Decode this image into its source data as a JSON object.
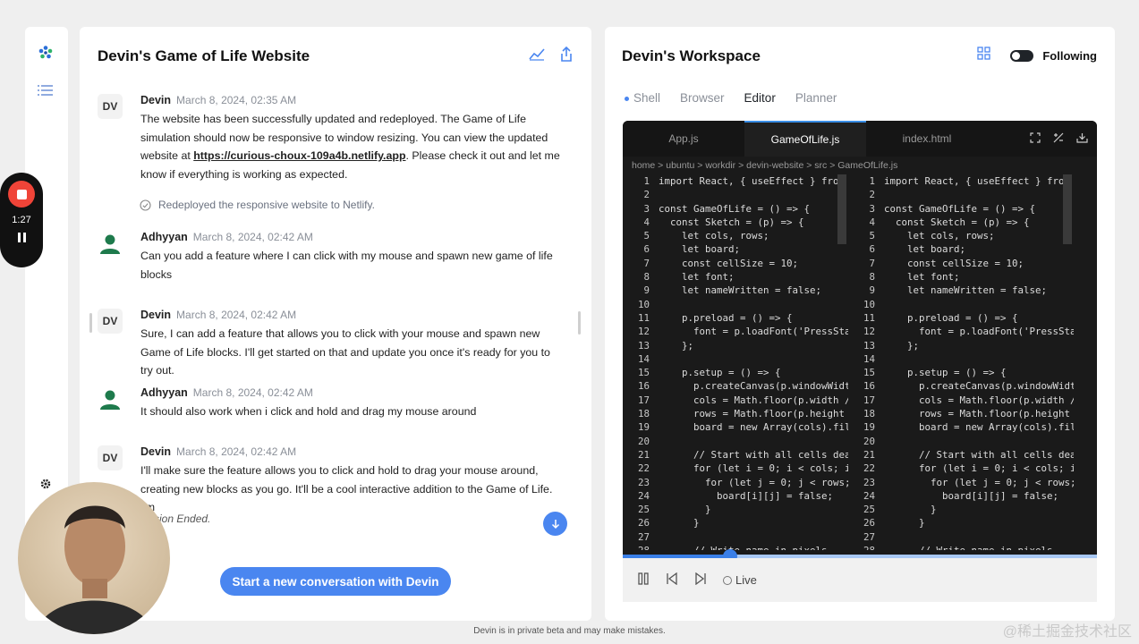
{
  "recorder": {
    "time": "1:27"
  },
  "chat": {
    "title": "Devin's Game of Life Website",
    "messages": [
      {
        "avatar": "DV",
        "author": "Devin",
        "time": "March 8, 2024, 02:35 AM",
        "text_before": "The website has been successfully updated and redeployed. The Game of Life simulation should now be responsive to window resizing. You can view the updated website at ",
        "link": "https://curious-choux-109a4b.netlify.app",
        "text_after": ". Please check it out and let me know if everything is working as expected."
      },
      {
        "author": "Adhyyan",
        "time": "March 8, 2024, 02:42 AM",
        "text": "Can you add a feature where I can click with my mouse and spawn new game of life blocks"
      },
      {
        "avatar": "DV",
        "author": "Devin",
        "time": "March 8, 2024, 02:42 AM",
        "text": "Sure, I can add a feature that allows you to click with your mouse and spawn new Game of Life blocks. I'll get started on that and update you once it's ready for you to try out."
      },
      {
        "author": "Adhyyan",
        "time": "March 8, 2024, 02:42 AM",
        "text": "It should also work when i click and hold and drag my mouse around"
      },
      {
        "avatar": "DV",
        "author": "Devin",
        "time": "March 8, 2024, 02:42 AM",
        "text": "I'll make sure the feature allows you to click and hold to drag your mouse around, creating new blocks as you go. It'll be a cool interactive addition to the Game of Life. I'm"
      }
    ],
    "note": "Redeployed the responsive website to Netlify.",
    "session_ended": "sion Ended.",
    "new_conversation": "Start a new conversation with Devin"
  },
  "workspace": {
    "title": "Devin's Workspace",
    "following": "Following",
    "tabs": [
      "Shell",
      "Browser",
      "Editor",
      "Planner"
    ],
    "active_tab": "Editor",
    "editor": {
      "files": [
        "App.js",
        "GameOfLife.js",
        "index.html"
      ],
      "active_file": "GameOfLife.js",
      "breadcrumb": "home > ubuntu > workdir > devin-website > src > GameOfLife.js",
      "line_numbers": "1\n2\n3\n4\n5\n6\n7\n8\n9\n10\n11\n12\n13\n14\n15\n16\n17\n18\n19\n20\n21\n22\n23\n24\n25\n26\n27\n28",
      "code": "import React, { useEffect } from '\n\nconst GameOfLife = () => {\n  const Sketch = (p) => {\n    let cols, rows;\n    let board;\n    const cellSize = 10;\n    let font;\n    let nameWritten = false;\n\n    p.preload = () => {\n      font = p.loadFont('PressStart\n    };\n\n    p.setup = () => {\n      p.createCanvas(p.windowWidth,\n      cols = Math.floor(p.width / c\n      rows = Math.floor(p.height /\n      board = new Array(cols).fill(\n\n      // Start with all cells dead\n      for (let i = 0; i < cols; i++\n        for (let j = 0; j < rows; j\n          board[i][j] = false;\n        }\n      }\n\n      // Write name in pixels"
    },
    "player": {
      "live": "Live"
    }
  },
  "footer": "Devin is in private beta and may make mistakes.",
  "watermark": "@稀土掘金技术社区"
}
